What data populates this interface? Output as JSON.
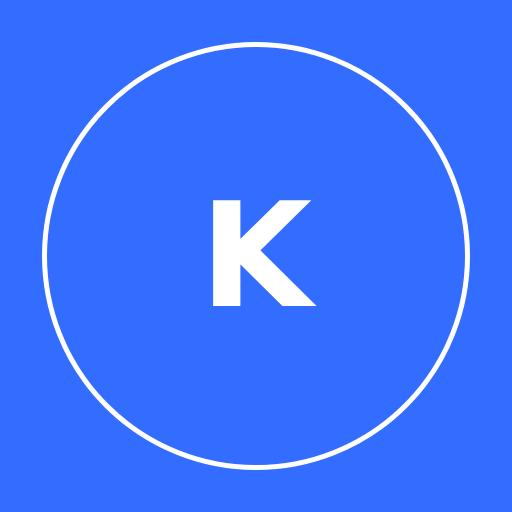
{
  "avatar": {
    "initial": "K",
    "colors": {
      "background": "#336dff",
      "ring": "#ffffff",
      "text": "#ffffff"
    }
  }
}
